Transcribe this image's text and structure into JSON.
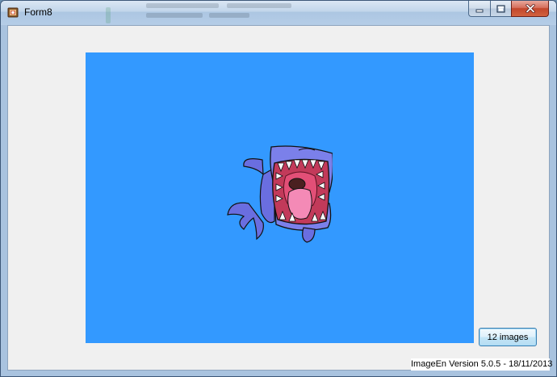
{
  "window": {
    "title": "Form8"
  },
  "caption_buttons": {
    "minimize_icon": "minimize-icon",
    "maximize_icon": "maximize-icon",
    "close_icon": "close-icon"
  },
  "image_viewer": {
    "background_color": "#3399ff",
    "image_subject": "shark-cartoon"
  },
  "images_button": {
    "label": "12 images"
  },
  "footer": {
    "version_text": "ImageEn Version 5.0.5 - 18/11/2013"
  }
}
